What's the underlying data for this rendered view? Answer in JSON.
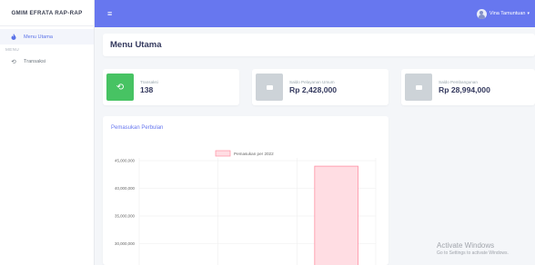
{
  "sidebar": {
    "brand": "GMIM EFRATA RAP-RAP",
    "items": [
      {
        "label": "Menu Utama",
        "icon": "fire-icon",
        "active": true
      },
      {
        "label": "Transaksi",
        "icon": "history-icon",
        "active": false
      }
    ],
    "section_heading": "MENU"
  },
  "topbar": {
    "menu_icon": "hamburger-icon",
    "user_name": "Vina Tamuntuan"
  },
  "header": {
    "title": "Menu Utama"
  },
  "stats": [
    {
      "label": "Transaksi",
      "value": "138",
      "color": "#47c363",
      "icon": "history-icon"
    },
    {
      "label": "Saldo Pelayanan Umum",
      "value": "Rp 2,428,000",
      "color": "#cdd3d8",
      "icon": "square-icon"
    },
    {
      "label": "Saldo Pembangunan",
      "value": "Rp 28,994,000",
      "color": "#cdd3d8",
      "icon": "square-icon"
    }
  ],
  "chart_card": {
    "title": "Pemasukan Perbulan"
  },
  "chart_data": {
    "type": "bar",
    "title": "",
    "categories": [
      "",
      "",
      ""
    ],
    "series": [
      {
        "name": "Pemasukan per 2022",
        "values": [
          0,
          0,
          44000000
        ]
      }
    ],
    "yticks": [
      "45,000,000",
      "40,000,000",
      "35,000,000",
      "30,000,000"
    ],
    "ylim": [
      28000000,
      47000000
    ],
    "grid": true,
    "legend": "top",
    "bar_fill": "#ffdde3",
    "bar_stroke": "#ff8fa3"
  },
  "watermark": {
    "title": "Activate Windows",
    "subtitle": "Go to Settings to activate Windows."
  }
}
